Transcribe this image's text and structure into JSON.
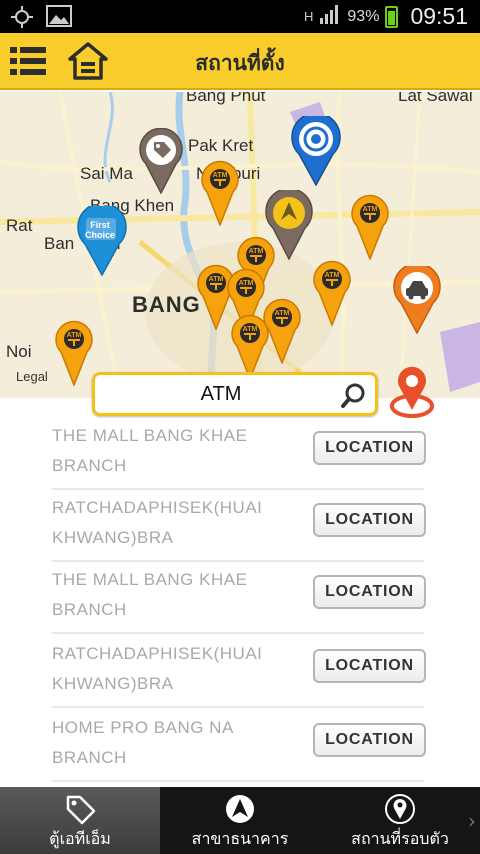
{
  "status_bar": {
    "network": "H",
    "battery": "93%",
    "time": "09:51"
  },
  "header": {
    "title": "สถานที่ตั้ง"
  },
  "map": {
    "labels": {
      "bang_phut": "Bang Phut",
      "lat_sawai": "Lat Sawai",
      "pak_kret": "Pak Kret",
      "sai_ma": "Sai Ma",
      "nonthaburi": "Nthaburi",
      "bang_khen": "Bang Khen",
      "rat": "Rat",
      "ban_huai": "Ban     uai",
      "bangkok": "BANG",
      "noi": "Noi",
      "legal": "Legal"
    },
    "pin_text": "ATM"
  },
  "search": {
    "value": "ATM"
  },
  "branches": [
    {
      "name": "THE MALL BANG KHAE BRANCH",
      "button": "LOCATION"
    },
    {
      "name": "RATCHADAPHISEK(HUAI KHWANG)BRA",
      "button": "LOCATION"
    },
    {
      "name": "THE MALL BANG KHAE BRANCH",
      "button": "LOCATION"
    },
    {
      "name": "RATCHADAPHISEK(HUAI KHWANG)BRA",
      "button": "LOCATION"
    },
    {
      "name": "HOME PRO BANG NA BRANCH",
      "button": "LOCATION"
    }
  ],
  "bottom_nav": [
    {
      "label": "ตู้เอทีเอ็ม",
      "icon": "tag-icon",
      "active": true
    },
    {
      "label": "สาขาธนาคาร",
      "icon": "bank-logo-icon",
      "active": false
    },
    {
      "label": "สถานที่รอบตัว",
      "icon": "location-pin-icon",
      "active": false
    }
  ],
  "colors": {
    "accent": "#f9cd2b",
    "pin_orange": "#f5a20d",
    "nav_bg": "#151515"
  }
}
